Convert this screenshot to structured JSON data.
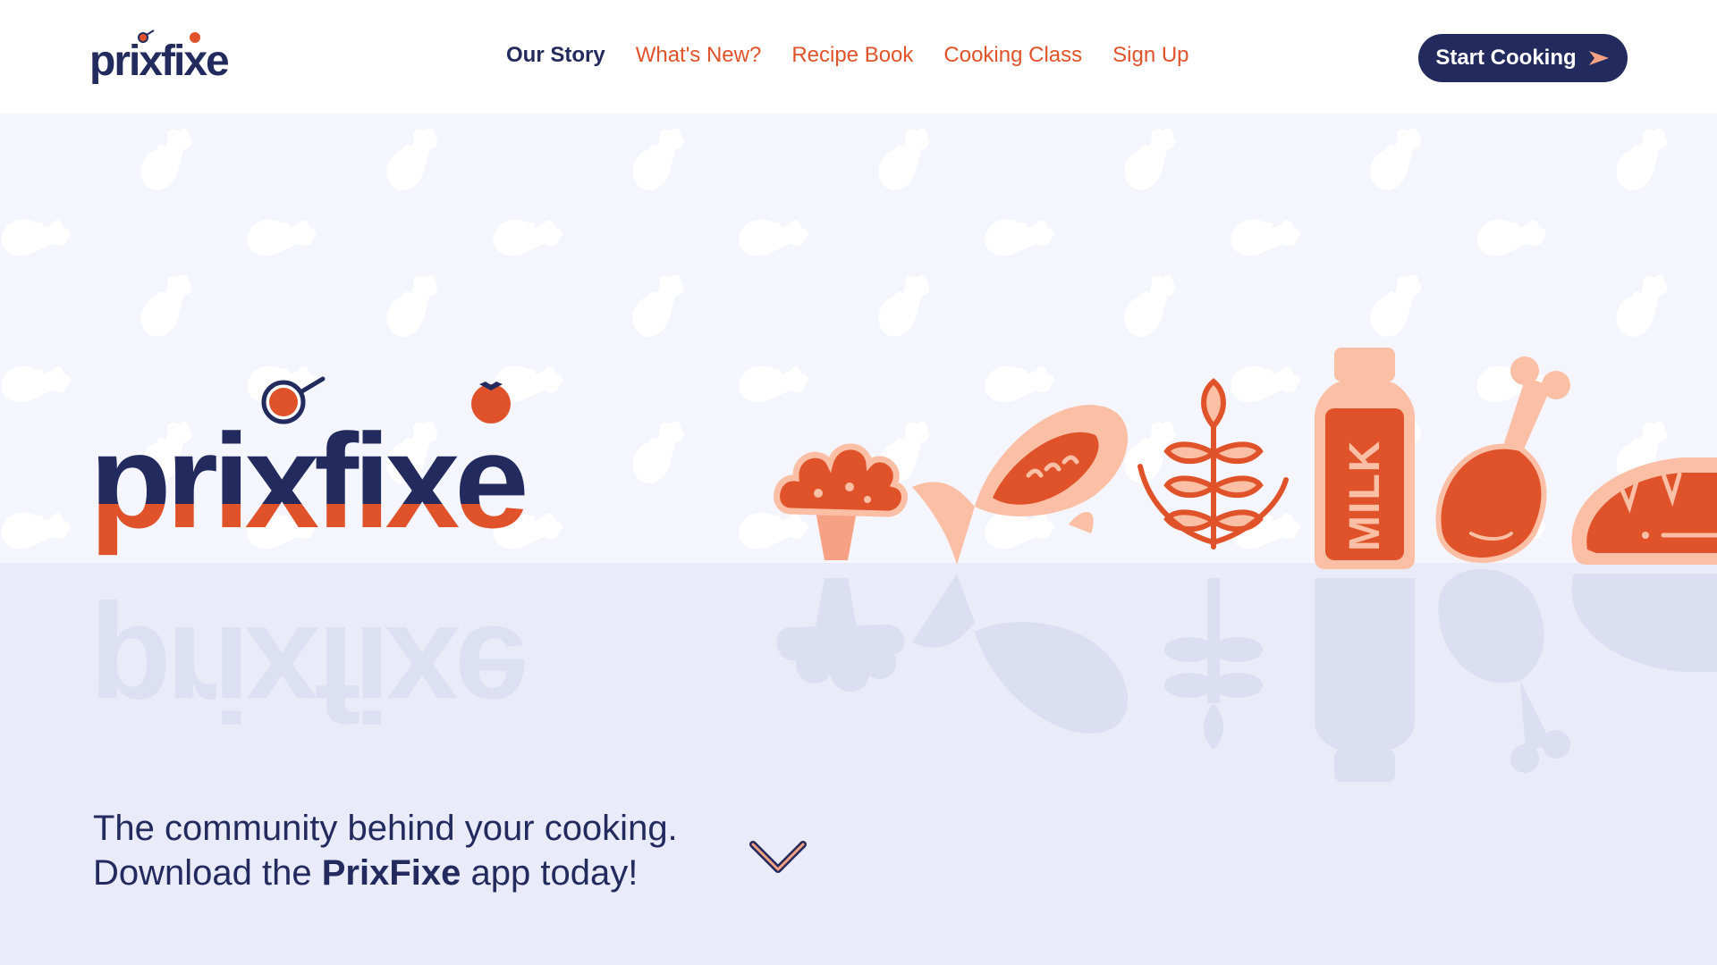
{
  "header": {
    "logo_text": "prixfixe",
    "nav": [
      {
        "label": "Our Story",
        "active": true
      },
      {
        "label": "What's New?",
        "active": false
      },
      {
        "label": "Recipe Book",
        "active": false
      },
      {
        "label": "Cooking Class",
        "active": false
      },
      {
        "label": "Sign Up",
        "active": false
      }
    ],
    "cta_label": "Start Cooking",
    "cta_icon": "arrow-right-icon"
  },
  "hero": {
    "logo_text": "prixfixe",
    "foods": [
      "broccoli-icon",
      "fish-icon",
      "wheat-icon",
      "milk-bottle-icon",
      "chicken-leg-icon",
      "bread-icon"
    ],
    "milk_label": "MILK",
    "tagline_line1": "The community behind your cooking.",
    "tagline_line2_prefix": "Download the ",
    "tagline_brand": "PrixFixe",
    "tagline_line2_suffix": " app today!",
    "scroll_icon": "chevron-down-icon"
  },
  "colors": {
    "navy": "#222a5e",
    "orange": "#e0532a",
    "peach": "#fbbfa5",
    "background": "#f4f5fd",
    "floor": "#e9ebf8"
  }
}
